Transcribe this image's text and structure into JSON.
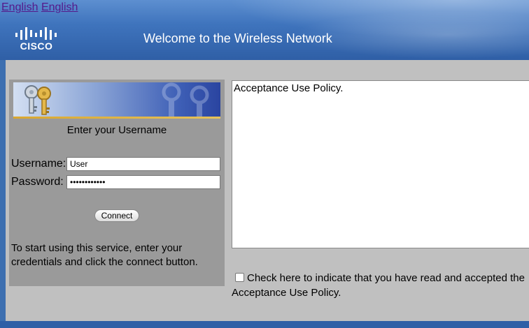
{
  "header": {
    "language_links": [
      "English",
      "English"
    ],
    "logo_text": "CISCO",
    "welcome": "Welcome to the Wireless Network"
  },
  "login": {
    "heading": "Enter your Username",
    "username_label": "Username:",
    "username_value": "User",
    "password_label": "Password:",
    "password_value": "••••••••••••",
    "connect_label": "Connect",
    "instructions": "To start using this service, enter your credentials and click the connect button."
  },
  "policy": {
    "text": "Acceptance Use Policy.",
    "accept_label": "Check here to indicate that you have read and accepted the Acceptance Use Policy."
  },
  "colors": {
    "header_blue": "#3f74bd",
    "panel_grey": "#9a9a9a",
    "body_grey": "#c0c0c0",
    "link_purple": "#551a8b"
  },
  "icons": [
    "cisco-logo-icon",
    "keys-icon"
  ]
}
